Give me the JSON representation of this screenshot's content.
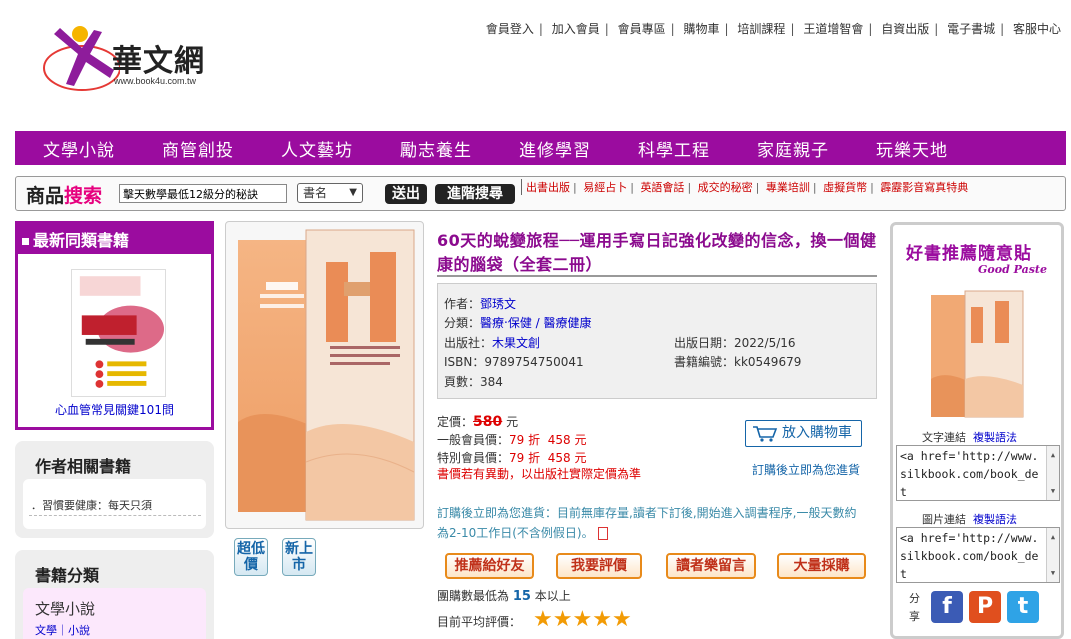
{
  "logo": {
    "name": "華文網",
    "url": "www.book4u.com.tw"
  },
  "top_links": [
    "會員登入",
    "加入會員",
    "會員專區",
    "購物車",
    "培訓課程",
    "王道增智會",
    "自資出版",
    "電子書城",
    "客服中心"
  ],
  "nav": [
    "文學小說",
    "商管創投",
    "人文藝坊",
    "勵志養生",
    "進修學習",
    "科學工程",
    "家庭親子",
    "玩樂天地"
  ],
  "search": {
    "label_a": "商品",
    "label_b": "搜索",
    "value": "擊天數學最低12級分的秘訣",
    "select": "書名",
    "submit": "送出",
    "advanced": "進階搜尋"
  },
  "hot_links": [
    "出書出版",
    "易經占卜",
    "英語會話",
    "成交的秘密",
    "專業培訓",
    "虛擬貨幣",
    "霹靂影音寫真特典"
  ],
  "sidebar": {
    "new_title": "最新同類書籍",
    "new_book": "心血管常見關鍵101問",
    "author_title": "作者相關書籍",
    "author_item": "．習慣要健康：每天只須",
    "cat_title": "書籍分類",
    "cat_main": "文學小說",
    "cat_sub": "文學｜小說"
  },
  "badges": [
    "超低價",
    "新上市"
  ],
  "book": {
    "title": "60天的蛻變旅程──運用手寫日記強化改變的信念，換一個健康的腦袋（全套二冊）",
    "author_label": "作者：",
    "author": "鄧琇文",
    "category_label": "分類：",
    "category": "醫療‧保健 / 醫療健康",
    "publisher_label": "出版社：",
    "publisher": "木果文創",
    "pub_date": "出版日期：2022/5/16",
    "isbn": "ISBN：9789754750041",
    "code": "書籍編號：kk0549679",
    "pages": "頁數：384"
  },
  "price": {
    "list_label": "定價：",
    "list_value": "580",
    "unit": "元",
    "member_label": "一般會員價：",
    "member_discount": "79 折",
    "member_price": "458 元",
    "special_label": "特別會員價：",
    "special_discount": "79 折",
    "special_price": "458 元",
    "notice": "書價若有異動，以出版社實際定價為準"
  },
  "cart": {
    "button": "放入購物車",
    "note": "訂購後立即為您進貨"
  },
  "status_text": "訂購後立即為您進貨：目前無庫存量,讀者下訂後,開始進入調書程序,一般天數約為2-10工作日(不含例假日)。",
  "actions": [
    "推薦給好友",
    "我要評價",
    "讀者樂留言",
    "大量採購"
  ],
  "group": {
    "prefix": "團購數最低為",
    "count": "15",
    "suffix": "本以上"
  },
  "rating": {
    "label": "目前平均評價：",
    "stars": 5
  },
  "right": {
    "title": "好書推薦隨意貼",
    "subtitle": "Good Paste",
    "text_link_label": "文字連結",
    "copy_label": "複製語法",
    "code_text": "<a href='http://www.silkbook.com/book_det",
    "image_link_label": "圖片連結",
    "share_label": "分享"
  },
  "colors": {
    "brand": "#9b0c9f",
    "price_red": "#dd0000",
    "link_blue": "#0000cc",
    "star": "#f29b05"
  }
}
